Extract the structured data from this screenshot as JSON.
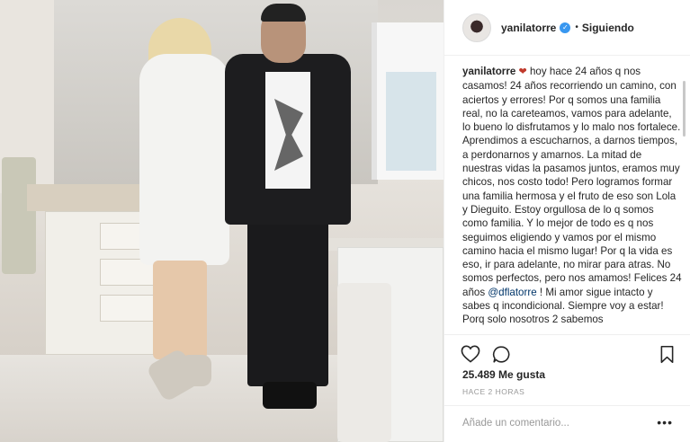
{
  "header": {
    "username": "yanilatorre",
    "verified_badge": "✓",
    "separator": "•",
    "follow_status": "Siguiendo"
  },
  "caption": {
    "username": "yanilatorre",
    "heart": "❤",
    "text_part1": " hoy hace 24 años q nos casamos! 24 años recorriendo un camino, con aciertos y errores! Por q somos una familia real, no la careteamos, vamos para adelante, lo bueno lo disfrutamos y lo malo nos fortalece. Aprendimos a escucharnos, a darnos tiempos, a perdonarnos y amarnos. La mitad de nuestras vidas la pasamos juntos, eramos muy chicos, nos costo todo! Pero logramos formar una familia hermosa y el fruto de eso son Lola y Dieguito. Estoy orgullosa de lo q somos como familia. Y lo mejor de todo es q nos seguimos eligiendo y vamos por el mismo camino hacia el mismo lugar! Por q la vida es eso, ir para adelante, no mirar para atras. No somos perfectos, pero nos amamos! Felices 24 años ",
    "mention": "@dflatorre",
    "text_part2": " ! Mi amor sigue intacto y sabes q incondicional. Siempre voy a estar! Porq solo nosotros 2 sabemos"
  },
  "actions": {
    "like_icon": "heart-outline-icon",
    "comment_icon": "comment-bubble-icon",
    "save_icon": "bookmark-icon"
  },
  "likes": "25.489 Me gusta",
  "timestamp": "HACE 2 HORAS",
  "comment_box": {
    "placeholder": "Añade un comentario...",
    "more_label": "•••"
  },
  "colors": {
    "text": "#262626",
    "muted": "#999999",
    "verified": "#3897f0",
    "heart": "#c0392b",
    "mention": "#003569",
    "border": "#efefef"
  }
}
